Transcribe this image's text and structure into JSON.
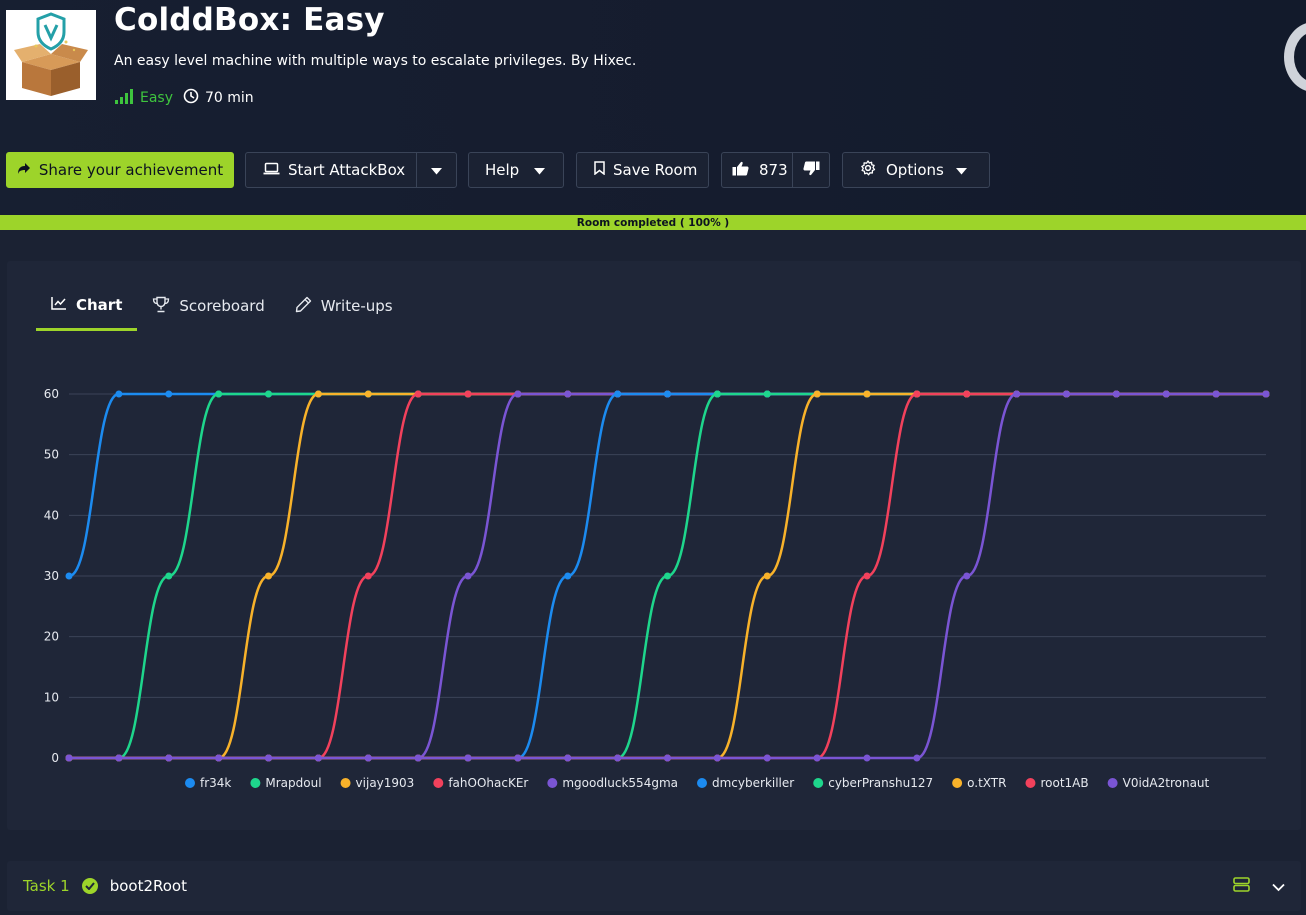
{
  "room": {
    "title": "ColddBox: Easy",
    "description": "An easy level machine with multiple ways to escalate privileges. By Hixec.",
    "difficulty": "Easy",
    "duration": "70 min"
  },
  "toolbar": {
    "share_label": "Share your achievement",
    "attackbox_label": "Start AttackBox",
    "help_label": "Help",
    "save_label": "Save Room",
    "upvotes": "873",
    "options_label": "Options"
  },
  "progress": {
    "label": "Room completed ( 100% )",
    "percent": 100
  },
  "tabs": [
    {
      "label": "Chart",
      "icon": "chart-line-icon",
      "active": true
    },
    {
      "label": "Scoreboard",
      "icon": "trophy-icon",
      "active": false
    },
    {
      "label": "Write-ups",
      "icon": "pen-icon",
      "active": false
    }
  ],
  "chart_data": {
    "type": "line",
    "title": "",
    "xlabel": "",
    "ylabel": "",
    "ylim": [
      0,
      60
    ],
    "yticks": [
      0,
      10,
      20,
      30,
      40,
      50,
      60
    ],
    "grid": true,
    "legend_position": "bottom",
    "points": 25,
    "series": [
      {
        "name": "fr34k",
        "color": "#1c8bf0",
        "values": [
          30,
          60,
          60,
          60,
          60,
          60,
          60,
          60,
          60,
          60,
          60,
          60,
          60,
          60,
          60,
          60,
          60,
          60,
          60,
          60,
          60,
          60,
          60,
          60,
          60
        ]
      },
      {
        "name": "Mrapdoul",
        "color": "#1ed68c",
        "values": [
          0,
          0,
          30,
          60,
          60,
          60,
          60,
          60,
          60,
          60,
          60,
          60,
          60,
          60,
          60,
          60,
          60,
          60,
          60,
          60,
          60,
          60,
          60,
          60,
          60
        ]
      },
      {
        "name": "vijay1903",
        "color": "#f8b22a",
        "values": [
          0,
          0,
          0,
          0,
          30,
          60,
          60,
          60,
          60,
          60,
          60,
          60,
          60,
          60,
          60,
          60,
          60,
          60,
          60,
          60,
          60,
          60,
          60,
          60,
          60
        ]
      },
      {
        "name": "fahOOhacKEr",
        "color": "#f2415c",
        "values": [
          0,
          0,
          0,
          0,
          0,
          0,
          30,
          60,
          60,
          60,
          60,
          60,
          60,
          60,
          60,
          60,
          60,
          60,
          60,
          60,
          60,
          60,
          60,
          60,
          60
        ]
      },
      {
        "name": "mgoodluck554gma",
        "color": "#7a55d4",
        "values": [
          0,
          0,
          0,
          0,
          0,
          0,
          0,
          0,
          30,
          60,
          60,
          60,
          60,
          60,
          60,
          60,
          60,
          60,
          60,
          60,
          60,
          60,
          60,
          60,
          60
        ]
      },
      {
        "name": "dmcyberkiller",
        "color": "#1c8bf0",
        "values": [
          0,
          0,
          0,
          0,
          0,
          0,
          0,
          0,
          0,
          0,
          30,
          60,
          60,
          60,
          60,
          60,
          60,
          60,
          60,
          60,
          60,
          60,
          60,
          60,
          60
        ]
      },
      {
        "name": "cyberPranshu127",
        "color": "#1ed68c",
        "values": [
          0,
          0,
          0,
          0,
          0,
          0,
          0,
          0,
          0,
          0,
          0,
          0,
          30,
          60,
          60,
          60,
          60,
          60,
          60,
          60,
          60,
          60,
          60,
          60,
          60
        ]
      },
      {
        "name": "o.tXTR",
        "color": "#f8b22a",
        "values": [
          0,
          0,
          0,
          0,
          0,
          0,
          0,
          0,
          0,
          0,
          0,
          0,
          0,
          0,
          30,
          60,
          60,
          60,
          60,
          60,
          60,
          60,
          60,
          60,
          60
        ]
      },
      {
        "name": "root1AB",
        "color": "#f2415c",
        "values": [
          0,
          0,
          0,
          0,
          0,
          0,
          0,
          0,
          0,
          0,
          0,
          0,
          0,
          0,
          0,
          0,
          30,
          60,
          60,
          60,
          60,
          60,
          60,
          60,
          60
        ]
      },
      {
        "name": "V0idA2tronaut",
        "color": "#7a55d4",
        "values": [
          0,
          0,
          0,
          0,
          0,
          0,
          0,
          0,
          0,
          0,
          0,
          0,
          0,
          0,
          0,
          0,
          0,
          0,
          30,
          60,
          60,
          60,
          60,
          60,
          60
        ]
      }
    ]
  },
  "task": {
    "number_label": "Task 1",
    "title": "boot2Root",
    "completed": true
  },
  "colors": {
    "accent": "#9dd42a",
    "background": "#1b2233",
    "panel": "#1f2638"
  }
}
